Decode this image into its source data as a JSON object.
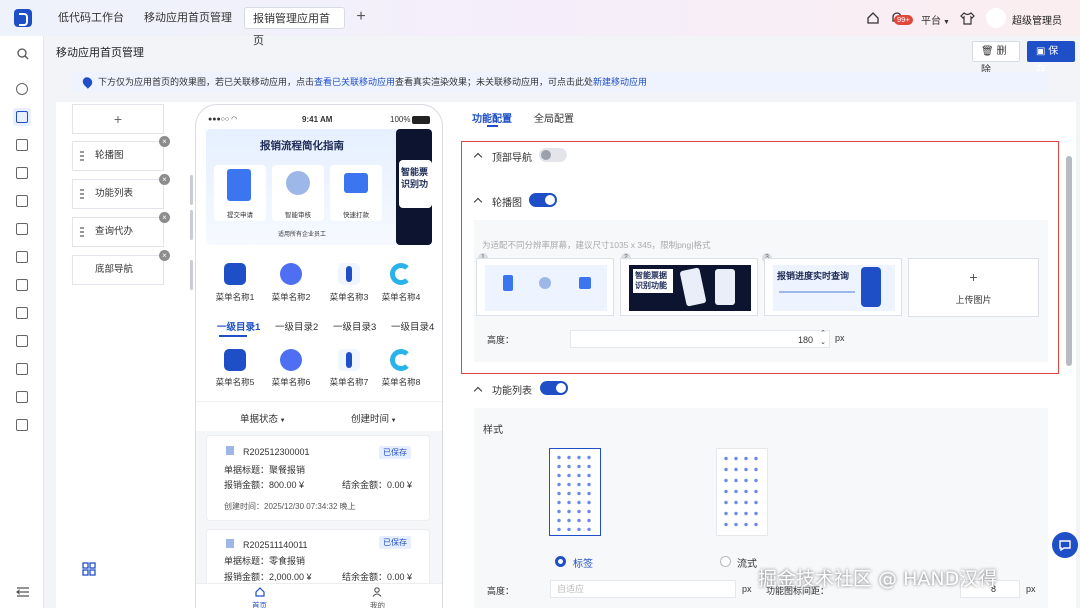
{
  "topbar": {
    "tabs": [
      "低代码工作台",
      "移动应用首页管理",
      "报销管理应用首页"
    ],
    "notification_count": "99+",
    "platform_label": "平台",
    "user_name": "超级管理员"
  },
  "page": {
    "title": "移动应用首页管理",
    "delete_label": "删除",
    "save_label": "保存"
  },
  "notice": {
    "text1": "下方仅为应用首页的效果图，若已关联移动应用，点击",
    "link1": "查看已关联移动应用",
    "text2": "查看真实渲染效果；未关联移动应用，可点击此处",
    "link2": "新建移动应用"
  },
  "components": {
    "add_symbol": "+",
    "items": [
      "轮播图",
      "功能列表",
      "查询代办",
      "底部导航"
    ]
  },
  "phone": {
    "time": "9:41 AM",
    "battery": "100%",
    "banner_title": "报销流程简化指南",
    "banner_cards": [
      "提交申请",
      "智能审核",
      "快速打款"
    ],
    "banner_footer": "适用所有企业员工",
    "banner_right_text": "智能票识别功",
    "menus_row1": [
      "菜单名称1",
      "菜单名称2",
      "菜单名称3",
      "菜单名称4"
    ],
    "categories": [
      "一级目录1",
      "一级目录2",
      "一级目录3",
      "一级目录4"
    ],
    "menus_row2": [
      "菜单名称5",
      "菜单名称6",
      "菜单名称7",
      "菜单名称8"
    ],
    "filter_status": "单据状态",
    "filter_time": "创建时间",
    "cards": [
      {
        "id": "R202512300001",
        "status": "已保存",
        "title": "单据标题：聚餐报销",
        "amount": "报销金额：800.00 ¥",
        "balance": "结余金额：0.00 ¥",
        "time": "创建时间：2025/12/30 07:34:32 晚上"
      },
      {
        "id": "R202511140011",
        "status": "已保存",
        "title": "单据标题：零食报销",
        "amount": "报销金额：2,000.00 ¥",
        "balance": "结余金额：0.00 ¥"
      }
    ],
    "nav_home": "首页",
    "nav_mine": "我的"
  },
  "config": {
    "tabs": [
      "功能配置",
      "全局配置"
    ],
    "top_nav_label": "顶部导航",
    "carousel_label": "轮播图",
    "carousel_hint": "为适配不同分辨率屏幕，建议尺寸1035 x 345，限制png|格式",
    "image_indices": [
      "1",
      "2",
      "3"
    ],
    "img2_text": "智能票据识别功能",
    "img3_text": "报销进度实时查询",
    "upload_symbol": "+",
    "upload_label": "上传图片",
    "height_label": "高度：",
    "height_value": "180",
    "unit_px": "px",
    "func_list_label": "功能列表",
    "style_label": "样式",
    "style_options": [
      "标签",
      "流式"
    ],
    "height2_label": "高度：",
    "height2_placeholder": "自适应",
    "unit_px2": "px",
    "icon_spacing_label": "功能图标间距：",
    "icon_spacing_value": "8",
    "unit_px3": "px"
  },
  "watermark": "掘金技术社区 @ HAND汉得",
  "colors": {
    "primary": "#1e4fc7",
    "highlight_border": "#e0483d"
  }
}
